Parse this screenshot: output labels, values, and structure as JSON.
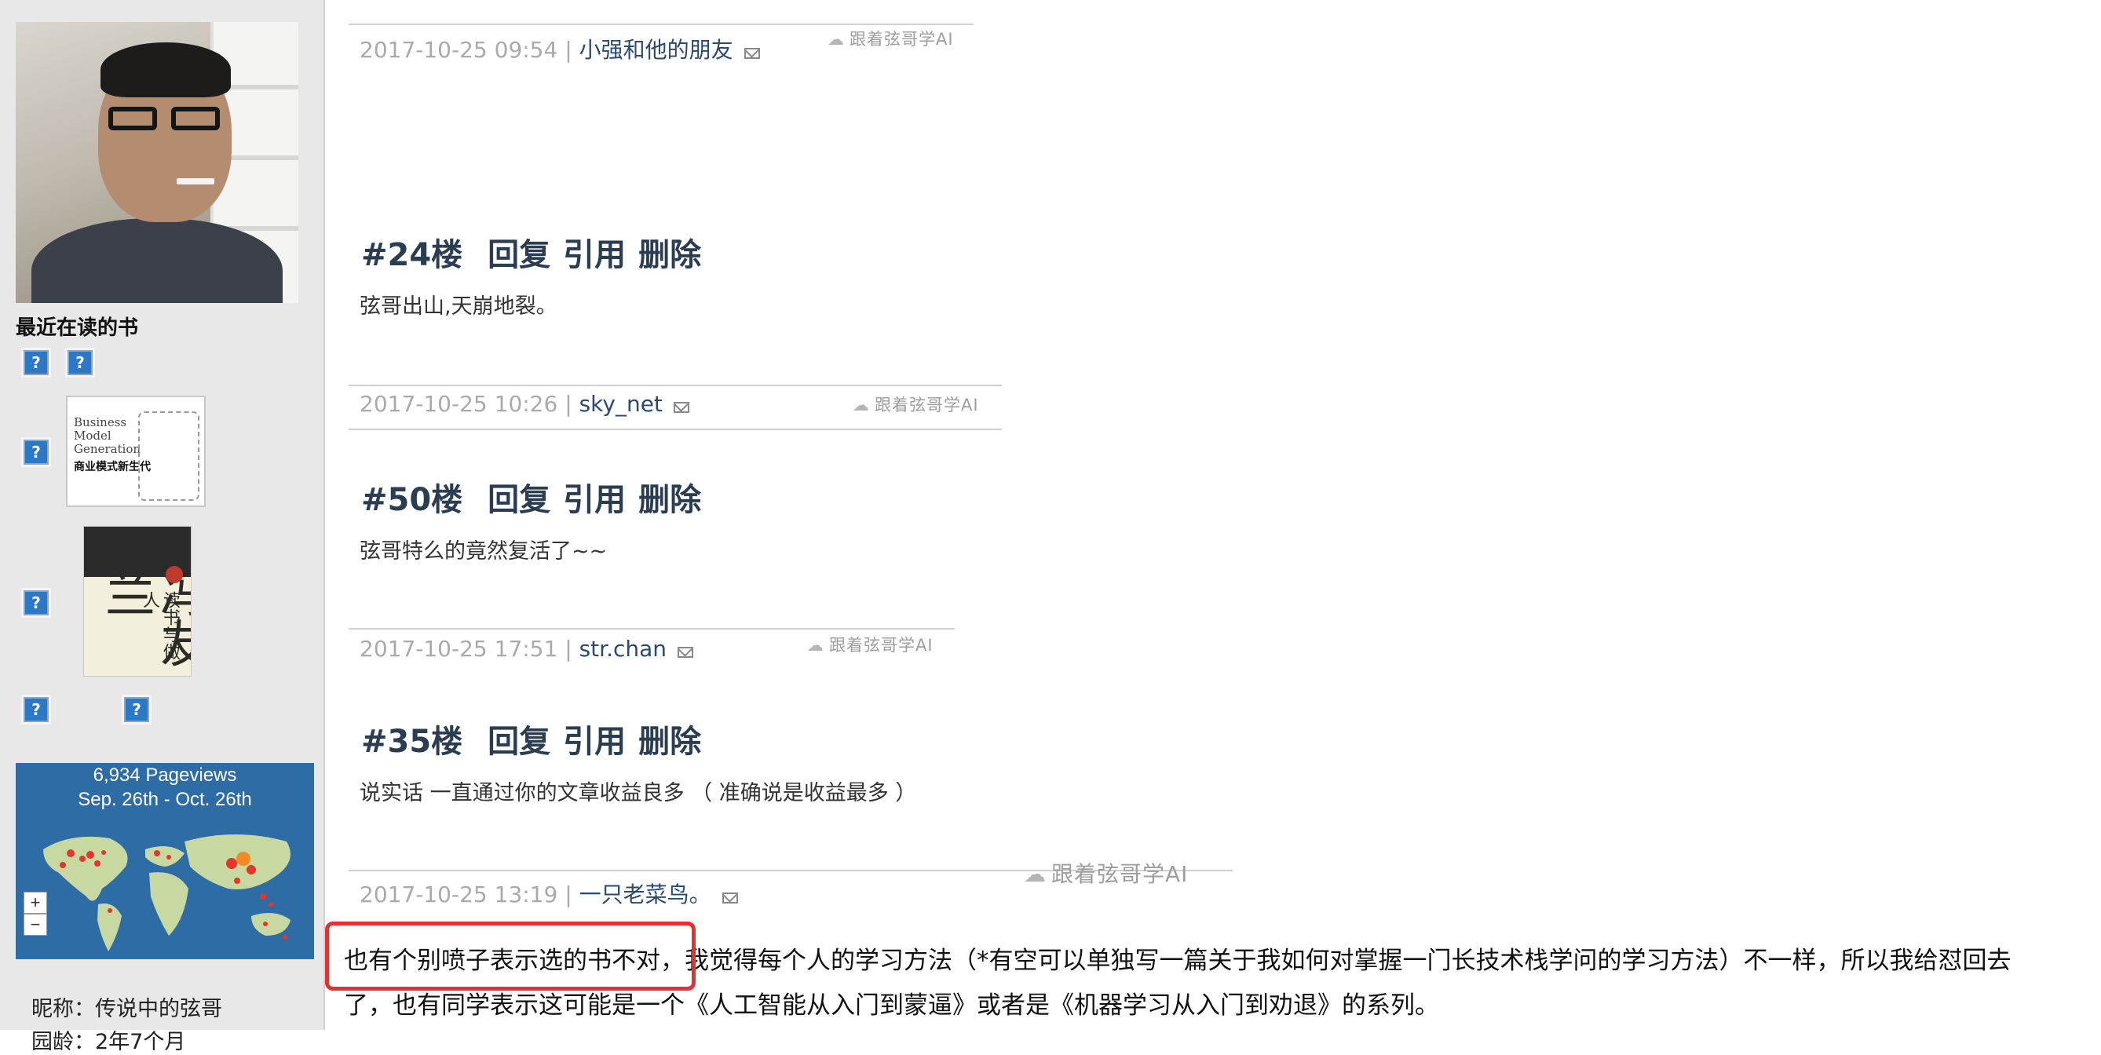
{
  "sidebar": {
    "recent_books_title": "最近在读的书",
    "book1": {
      "title_lines": [
        "Business",
        "Model",
        "Generation"
      ],
      "cn_title": "商业模式新生代"
    },
    "book2": {
      "calligraphy": "冯友兰",
      "subtitle": "读书与做人"
    },
    "map": {
      "pageviews": "6,934 Pageviews",
      "date_range": "Sep. 26th - Oct. 26th",
      "zoom_in": "+",
      "zoom_out": "−",
      "dot_color": "#e8342a",
      "land_color": "#c7d8a0",
      "ocean_color": "#2e6ca6"
    },
    "nickname": "昵称：传说中的弦哥",
    "nickname_next": "园龄：2年7个月"
  },
  "comments": [
    {
      "date": "2017-10-25 09:54",
      "user": "小强和他的朋友"
    },
    {
      "floor": "#24楼",
      "actions": [
        "回复",
        "引用",
        "删除"
      ],
      "text": "弦哥出山,天崩地裂。",
      "date": "2017-10-25 10:26",
      "user": "sky_net"
    },
    {
      "floor": "#50楼",
      "actions": [
        "回复",
        "引用",
        "删除"
      ],
      "text": "弦哥特么的竟然复活了~~",
      "date": "2017-10-25 17:51",
      "user": "str.chan"
    },
    {
      "floor": "#35楼",
      "actions": [
        "回复",
        "引用",
        "删除"
      ],
      "text": "说实话 一直通过你的文章收益良多 （ 准确说是收益最多 ）",
      "date": "2017-10-25 13:19",
      "user": "一只老菜鸟。"
    }
  ],
  "watermark": "跟着弦哥学AI",
  "separator": "|",
  "article": {
    "highlight": "也有个别喷子表示选的书不对，",
    "line1_rest": "我觉得每个人的学习方法（*有空可以单独写一篇关于我如何对掌握一门长技术栈学问的学习方法）不一样，所以我给怼回去",
    "line2": "了，也有同学表示这可能是一个《人工智能从入门到蒙逼》或者是《机器学习从入门到劝退》的系列。"
  },
  "colors": {
    "highlight_box": "#e0322e",
    "floor_text": "#2b3d50",
    "meta_gray": "#aaaaaa",
    "user_blue": "#2a4a6e"
  }
}
